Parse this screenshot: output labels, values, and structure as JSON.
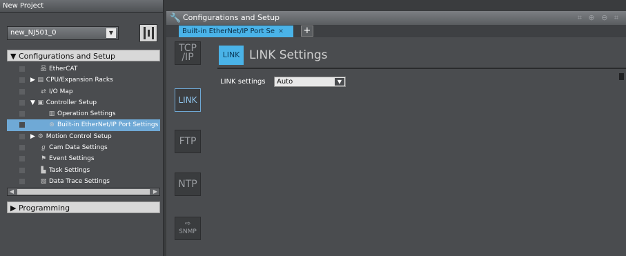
{
  "app": {
    "title": "New Project"
  },
  "project": {
    "selected": "new_NJ501_0"
  },
  "tree": {
    "config_header": "Configurations and Setup",
    "items": [
      {
        "label": "EtherCAT",
        "icon": "ethercat-icon",
        "glyph": "品"
      },
      {
        "label": "CPU/Expansion Racks",
        "icon": "rack-icon",
        "glyph": "▤"
      },
      {
        "label": "I/O Map",
        "icon": "io-map-icon",
        "glyph": "⇄"
      },
      {
        "label": "Controller Setup",
        "icon": "controller-icon",
        "glyph": "▣"
      },
      {
        "label": "Operation Settings",
        "icon": "operation-icon",
        "glyph": "▥"
      },
      {
        "label": "Built-in EtherNet/IP Port Settings",
        "icon": "ethernet-port-icon",
        "glyph": "⊛"
      },
      {
        "label": "Motion Control Setup",
        "icon": "motion-icon",
        "glyph": "⚙"
      },
      {
        "label": "Cam Data Settings",
        "icon": "cam-icon",
        "glyph": "ℊ"
      },
      {
        "label": "Event Settings",
        "icon": "event-flag-icon",
        "glyph": "⚑"
      },
      {
        "label": "Task Settings",
        "icon": "task-icon",
        "glyph": "▙"
      },
      {
        "label": "Data Trace Settings",
        "icon": "data-trace-icon",
        "glyph": "▧"
      }
    ],
    "programming_header": "Programming"
  },
  "editor": {
    "header_title": "Configurations and Setup",
    "tab_label": "Built-in EtherNet/IP Port Se",
    "side_buttons": [
      {
        "label": "TCP\n/IP",
        "name": "tcpip-button"
      },
      {
        "label": "LINK",
        "name": "link-button"
      },
      {
        "label": "FTP",
        "name": "ftp-button"
      },
      {
        "label": "NTP",
        "name": "ntp-button"
      },
      {
        "label": "SNMP",
        "name": "snmp-button"
      }
    ],
    "section_badge": "LINK",
    "section_title": "LINK Settings",
    "link_settings_label": "LINK settings",
    "link_settings_value": "Auto"
  },
  "colors": {
    "accent": "#4ab3e8",
    "selection": "#6fa9d6",
    "panel": "#4a4c4f"
  }
}
